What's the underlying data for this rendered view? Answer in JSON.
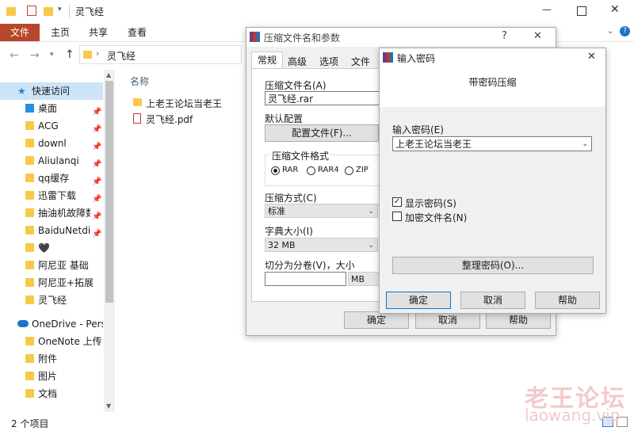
{
  "explorer": {
    "title": "灵飞经",
    "ribbon_tabs": [
      "文件",
      "主页",
      "共享",
      "查看"
    ],
    "breadcrumb": "灵飞经",
    "column_header": "名称",
    "nav_items": [
      {
        "label": "快速访问",
        "icon": "star-icon"
      },
      {
        "label": "桌面",
        "icon": "desktop-icon",
        "pinned": true
      },
      {
        "label": "ACG",
        "icon": "folder-icon",
        "pinned": true
      },
      {
        "label": "downl",
        "icon": "folder-icon",
        "pinned": true
      },
      {
        "label": "Aliulanqi",
        "icon": "folder-icon",
        "pinned": true
      },
      {
        "label": "qq缓存",
        "icon": "folder-icon",
        "pinned": true
      },
      {
        "label": "迅雷下载",
        "icon": "folder-icon",
        "pinned": true
      },
      {
        "label": "抽油机故障数",
        "icon": "folder-icon",
        "pinned": true
      },
      {
        "label": "BaiduNetdis",
        "icon": "folder-icon",
        "pinned": true
      },
      {
        "label": "🖤",
        "icon": "folder-icon"
      },
      {
        "label": "阿尼亚 基础",
        "icon": "folder-icon"
      },
      {
        "label": "阿尼亚+拓展",
        "icon": "folder-icon"
      },
      {
        "label": "灵飞经",
        "icon": "folder-icon"
      },
      {
        "label": "OneDrive - Perso",
        "icon": "cloud-icon"
      },
      {
        "label": "OneNote 上传",
        "icon": "folder-icon"
      },
      {
        "label": "附件",
        "icon": "folder-icon"
      },
      {
        "label": "图片",
        "icon": "folder-icon"
      },
      {
        "label": "文档",
        "icon": "folder-icon"
      }
    ],
    "files": [
      {
        "name": "上老王论坛当老王",
        "icon": "folder-icon"
      },
      {
        "name": "灵飞经.pdf",
        "icon": "pdf-icon"
      }
    ],
    "status_text": "2 个项目"
  },
  "archive_dialog": {
    "title": "压缩文件名和参数",
    "help_glyph": "?",
    "close_glyph": "✕",
    "tabs": [
      "常规",
      "高级",
      "选项",
      "文件"
    ],
    "archive_name_label": "压缩文件名(A)",
    "archive_name_value": "灵飞经.rar",
    "default_profile_label": "默认配置",
    "profiles_button": "配置文件(F)...",
    "format_group_label": "压缩文件格式",
    "formats": [
      "RAR",
      "RAR4",
      "ZIP"
    ],
    "selected_format": "RAR",
    "method_label": "压缩方式(C)",
    "method_value": "标准",
    "dict_label": "字典大小(I)",
    "dict_value": "32 MB",
    "split_label": "切分为分卷(V)，大小",
    "split_unit": "MB",
    "ok": "确定",
    "cancel": "取消",
    "help": "帮助"
  },
  "password_dialog": {
    "title": "输入密码",
    "close_glyph": "✕",
    "heading": "带密码压缩",
    "password_label": "输入密码(E)",
    "password_value": "上老王论坛当老王",
    "show_password": "显示密码(S)",
    "show_password_checked": true,
    "encrypt_names": "加密文件名(N)",
    "encrypt_names_checked": false,
    "organize_button": "整理密码(O)...",
    "ok": "确定",
    "cancel": "取消",
    "help": "帮助"
  },
  "watermark": {
    "cn": "老王论坛",
    "en": "laowang.vip"
  }
}
